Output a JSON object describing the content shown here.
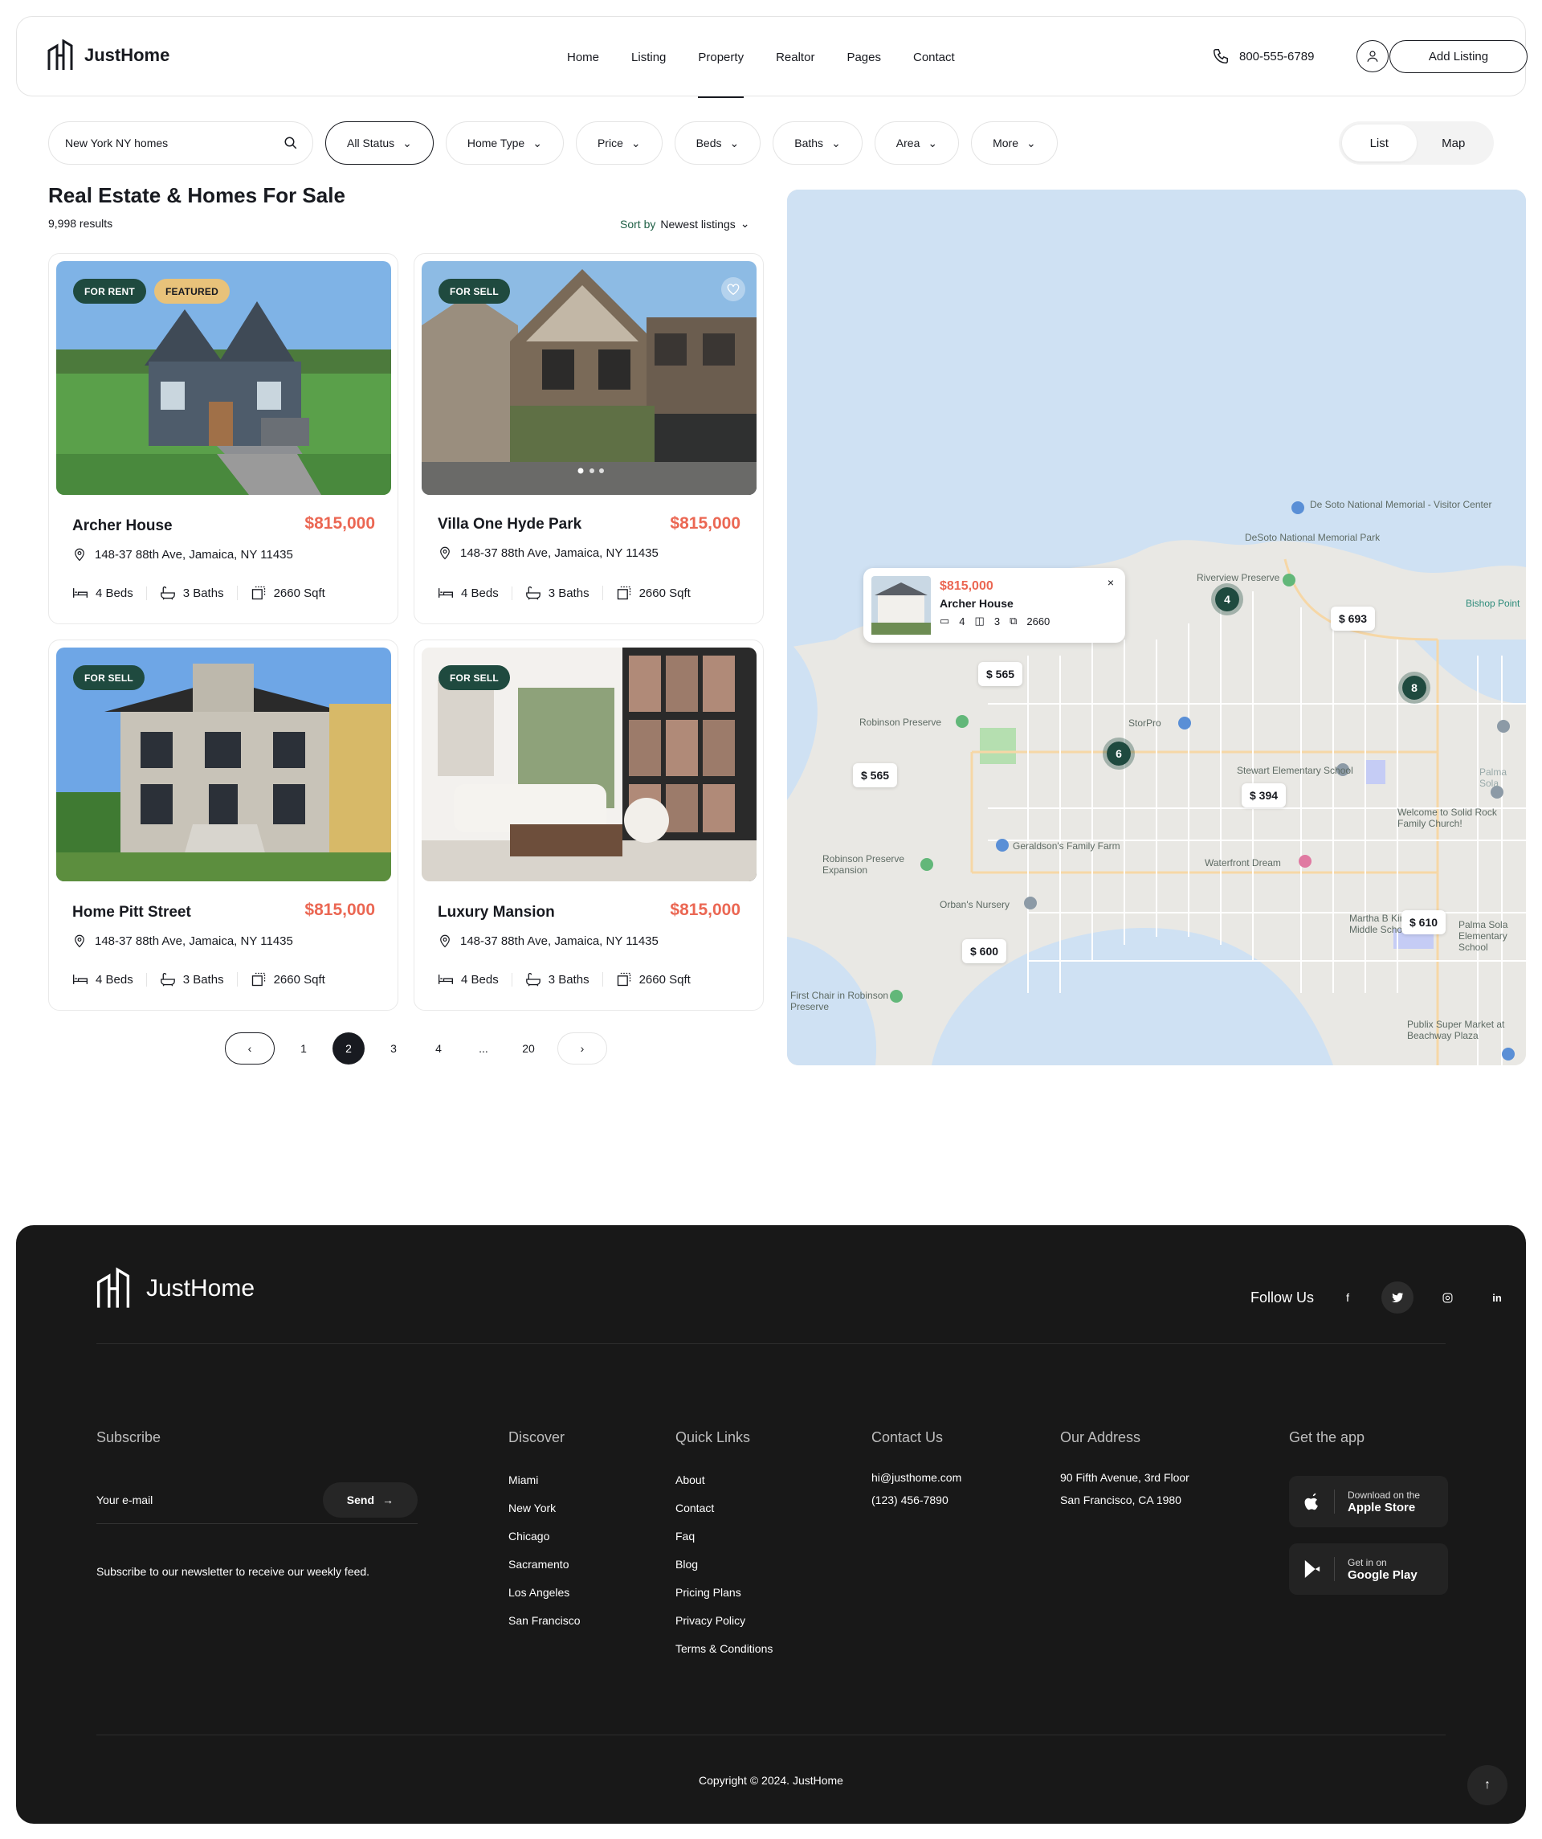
{
  "brand": {
    "name": "JustHome"
  },
  "nav": {
    "items": [
      "Home",
      "Listing",
      "Property",
      "Realtor",
      "Pages",
      "Contact"
    ],
    "active": "Property"
  },
  "header": {
    "phone": "800-555-6789",
    "add_listing": "Add Listing"
  },
  "filters": {
    "search_value": "New York NY homes",
    "chips": [
      "All Status",
      "Home Type",
      "Price",
      "Beds",
      "Baths",
      "Area",
      "More"
    ],
    "active_chip": "All Status"
  },
  "view_toggle": {
    "list": "List",
    "map": "Map",
    "selected": "List"
  },
  "listing": {
    "title": "Real Estate & Homes For Sale",
    "results": "9,998 results",
    "sort_label": "Sort by",
    "sort_value": "Newest listings"
  },
  "cards": [
    {
      "name": "Archer House",
      "price": "$815,000",
      "address": "148-37 88th Ave, Jamaica, NY 11435",
      "beds": "4 Beds",
      "baths": "3 Baths",
      "sqft": "2660 Sqft",
      "badges": [
        "FOR RENT",
        "FEATURED"
      ]
    },
    {
      "name": "Villa One Hyde Park",
      "price": "$815,000",
      "address": "148-37 88th Ave, Jamaica, NY 11435",
      "beds": "4 Beds",
      "baths": "3 Baths",
      "sqft": "2660 Sqft",
      "badges": [
        "FOR SELL"
      ]
    },
    {
      "name": "Home Pitt Street",
      "price": "$815,000",
      "address": "148-37 88th Ave, Jamaica, NY 11435",
      "beds": "4 Beds",
      "baths": "3 Baths",
      "sqft": "2660 Sqft",
      "badges": [
        "FOR SELL"
      ]
    },
    {
      "name": "Luxury Mansion",
      "price": "$815,000",
      "address": "148-37 88th Ave, Jamaica, NY 11435",
      "beds": "4 Beds",
      "baths": "3 Baths",
      "sqft": "2660 Sqft",
      "badges": [
        "FOR SELL"
      ]
    }
  ],
  "pagination": {
    "pages": [
      "1",
      "2",
      "3",
      "4",
      "...",
      "20"
    ],
    "current": "2"
  },
  "map": {
    "popup": {
      "price": "$815,000",
      "name": "Archer House",
      "beds": "4",
      "baths": "3",
      "sqft": "2660",
      "close": "×"
    },
    "price_pins": [
      "$ 565",
      "$ 565",
      "$ 693",
      "$ 394",
      "$ 600",
      "$ 610"
    ],
    "clusters": [
      "4",
      "8",
      "6"
    ],
    "places": [
      "De Soto National Memorial - Visitor Center",
      "DeSoto National Memorial Park",
      "Riverview Preserve",
      "Bishop Point",
      "Robinson Preserve",
      "StorPro",
      "Stewart Elementary School",
      "Welcome to Solid Rock Family Church!",
      "Geraldson's Family Farm",
      "Robinson Preserve Expansion",
      "Waterfront Dream",
      "Orban's Nursery",
      "Martha B King Middle School",
      "Palma Sola Elementary School",
      "First Chair in Robinson Preserve",
      "Publix Super Market at Beachway Plaza",
      "Palma Sola"
    ]
  },
  "footer": {
    "follow_us": "Follow Us",
    "social": [
      "f",
      "twitter",
      "instagram",
      "in"
    ],
    "subscribe": {
      "title": "Subscribe",
      "placeholder": "Your e-mail",
      "send": "Send",
      "note": "Subscribe to our newsletter to receive our weekly feed."
    },
    "discover": {
      "title": "Discover",
      "items": [
        "Miami",
        "New York",
        "Chicago",
        "Sacramento",
        "Los Angeles",
        "San Francisco"
      ]
    },
    "quick_links": {
      "title": "Quick Links",
      "items": [
        "About",
        "Contact",
        "Faq",
        "Blog",
        "Pricing Plans",
        "Privacy Policy",
        "Terms & Conditions"
      ]
    },
    "contact": {
      "title": "Contact Us",
      "email": "hi@justhome.com",
      "phone": "(123) 456-7890"
    },
    "address": {
      "title": "Our Address",
      "line1": "90 Fifth Avenue, 3rd Floor",
      "line2": "San Francisco, CA 1980"
    },
    "app": {
      "title": "Get the app",
      "apple_small": "Download on the",
      "apple_big": "Apple Store",
      "google_small": "Get in on",
      "google_big": "Google Play"
    },
    "copyright": "Copyright © 2024. JustHome"
  }
}
